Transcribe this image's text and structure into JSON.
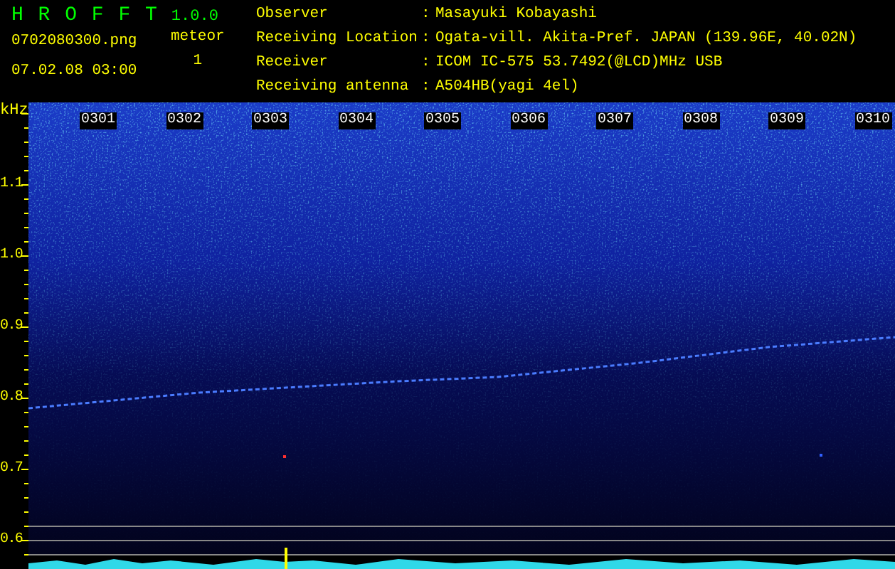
{
  "app": {
    "name": "H R O F F T",
    "version": "1.0.0"
  },
  "file": {
    "name": "0702080300.png",
    "datetime": "07.02.08 03:00"
  },
  "meteor": {
    "label": "meteor",
    "count": "1"
  },
  "info": [
    {
      "label": "Observer",
      "separator": ":",
      "value": "Masayuki Kobayashi"
    },
    {
      "label": "Receiving Location",
      "separator": ":",
      "value": "Ogata-vill. Akita-Pref. JAPAN (139.96E, 40.02N)"
    },
    {
      "label": "Receiver",
      "separator": ":",
      "value": "ICOM IC-575 53.7492(@LCD)MHz USB"
    },
    {
      "label": "Receiving antenna",
      "separator": ":",
      "value": "A504HB(yagi 4el)"
    }
  ],
  "spectrogram": {
    "y_unit": "kHz",
    "y_ticks": [
      "1.1",
      "1.0",
      "0.9",
      "0.8",
      "0.7",
      "0.6"
    ],
    "time_labels": [
      "0301",
      "0302",
      "0303",
      "0304",
      "0305",
      "0306",
      "0307",
      "0308",
      "0309",
      "0310"
    ]
  }
}
